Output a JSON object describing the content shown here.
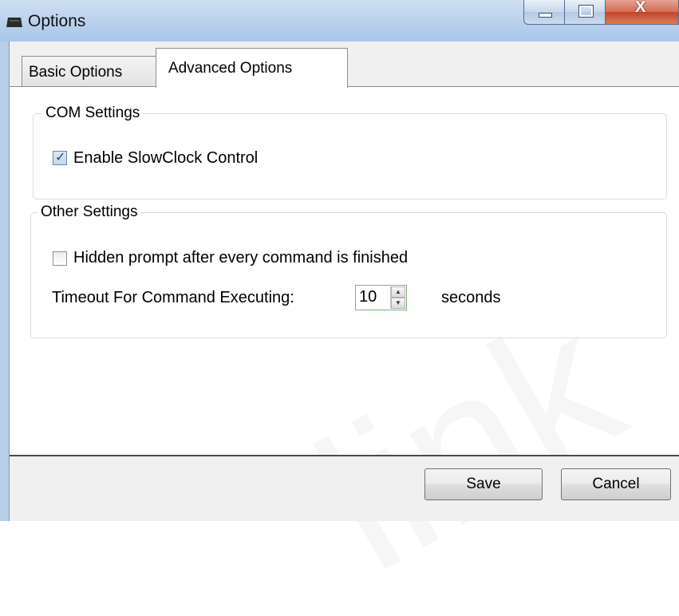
{
  "window": {
    "title": "Options",
    "icon": "keyboard-app-icon",
    "controls": {
      "minimize": "minimize-icon",
      "maximize": "maximize-icon",
      "close": "X"
    }
  },
  "tabs": [
    {
      "label": "Basic Options",
      "active": false
    },
    {
      "label": "Advanced Options",
      "active": true
    }
  ],
  "com_settings": {
    "legend": "COM Settings",
    "enable_slowclock": {
      "label": "Enable SlowClock Control",
      "checked": true
    }
  },
  "other_settings": {
    "legend": "Other Settings",
    "hidden_prompt": {
      "label": "Hidden prompt after every command is finished",
      "checked": false
    },
    "timeout": {
      "label": "Timeout For Command Executing:",
      "value": "10",
      "unit": "seconds"
    }
  },
  "buttons": {
    "save": "Save",
    "cancel": "Cancel"
  },
  "watermark": "link",
  "colors": {
    "titlebar": "#bdd3ee",
    "close_button": "#c4442a",
    "spinner_border": "#7fb07f"
  }
}
